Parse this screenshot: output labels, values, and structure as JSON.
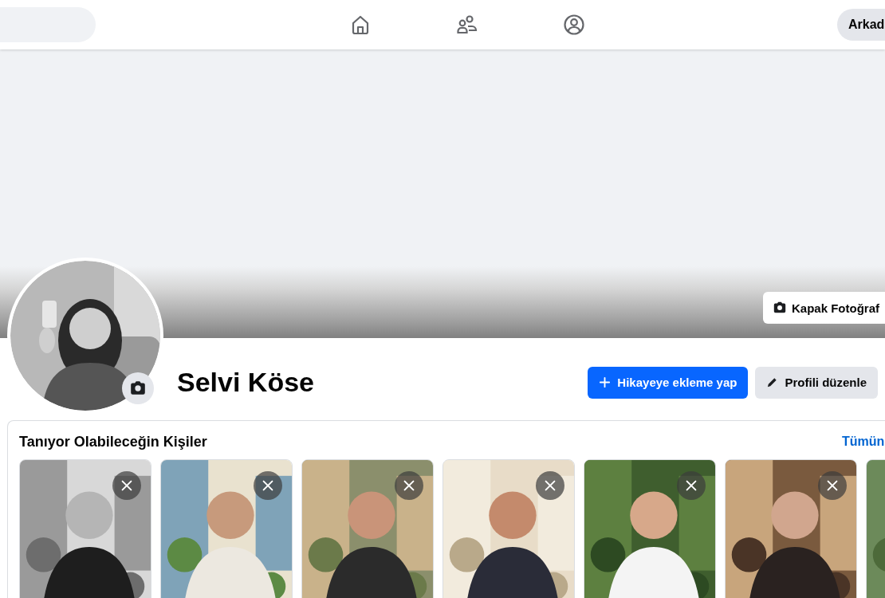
{
  "top_bar": {
    "nav": [
      {
        "kind": "home"
      },
      {
        "kind": "friends"
      },
      {
        "kind": "profile"
      }
    ],
    "button": "Arkad"
  },
  "cover": {
    "button": "Kapak Fotoğraf"
  },
  "profile": {
    "avatar": {
      "kind": "picture"
    },
    "name": "Selvi Köse",
    "buttons": [
      {
        "label": "Hikayeye ekleme yap",
        "kind": "primary"
      },
      {
        "label": "Profili düzenle",
        "kind": "secondary"
      }
    ]
  },
  "suggestions": {
    "title": "Tanıyor Olabileceğin Kişiler",
    "link": "Tümün",
    "people": [
      {
        "kind": "picture",
        "close_button": true
      },
      {
        "kind": "picture",
        "close_button": true
      },
      {
        "kind": "picture",
        "close_button": true
      },
      {
        "kind": "picture",
        "close_button": true
      },
      {
        "kind": "picture",
        "close_button": true
      },
      {
        "kind": "picture",
        "close_button": true
      },
      {
        "kind": "picture"
      }
    ]
  }
}
